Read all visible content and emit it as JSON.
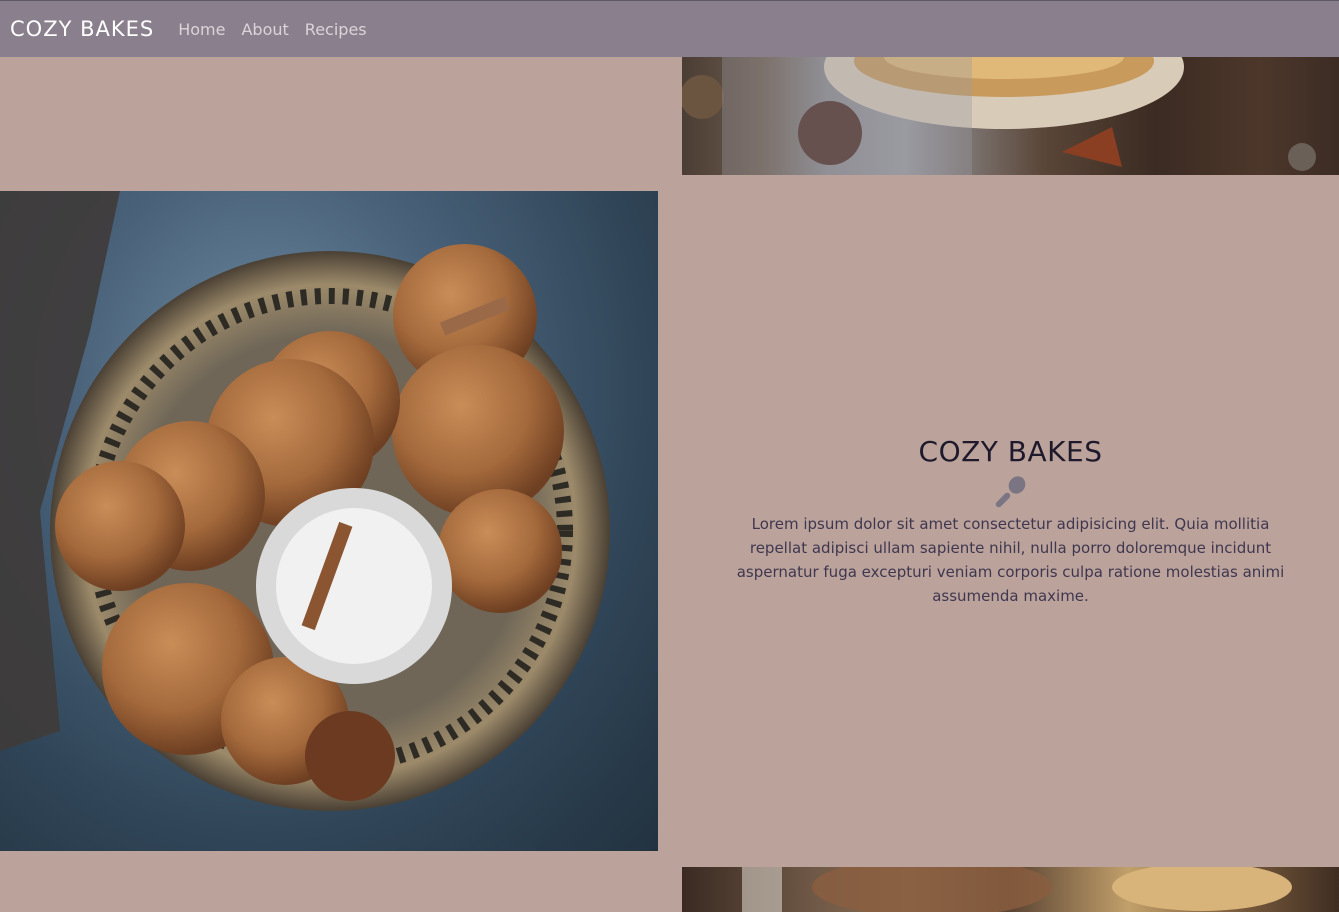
{
  "navbar": {
    "brand": "COZY BAKES",
    "links": [
      "Home",
      "About",
      "Recipes"
    ]
  },
  "about": {
    "title": "COZY BAKES",
    "icon": "spoon-icon",
    "text": "Lorem ipsum dolor sit amet consectetur adipisicing elit. Quia mollitia repellat adipisci ullam sapiente nihil, nulla porro doloremque incidunt aspernatur fuga excepturi veniam corporis culpa ratione molestias animi assumenda maxime."
  },
  "colors": {
    "navbar_bg": "#8a7f8d",
    "page_bg": "#bba39b",
    "title_text": "#1f1a2b",
    "body_text": "#3f3750"
  }
}
